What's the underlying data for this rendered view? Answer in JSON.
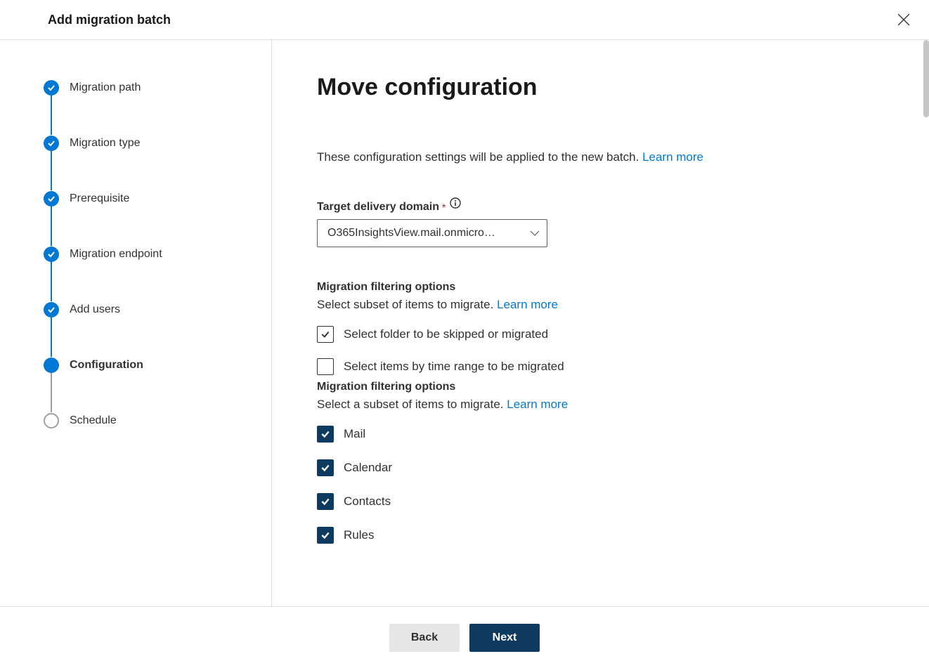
{
  "header": {
    "title": "Add migration batch"
  },
  "steps": [
    {
      "label": "Migration path",
      "state": "completed"
    },
    {
      "label": "Migration type",
      "state": "completed"
    },
    {
      "label": "Prerequisite",
      "state": "completed"
    },
    {
      "label": "Migration endpoint",
      "state": "completed"
    },
    {
      "label": "Add users",
      "state": "completed"
    },
    {
      "label": "Configuration",
      "state": "current"
    },
    {
      "label": "Schedule",
      "state": "upcoming"
    }
  ],
  "main": {
    "title": "Move configuration",
    "intro": "These configuration settings will be applied to the new batch. ",
    "learn_more": "Learn more",
    "domain_label": "Target delivery domain",
    "domain_value": "O365InsightsView.mail.onmicro…",
    "filter1_heading": "Migration filtering options",
    "filter1_sub": "Select subset of items to migrate. ",
    "cb_folder": "Select folder to be skipped or migrated",
    "cb_time": "Select items by time range to be migrated",
    "filter2_heading": "Migration filtering options",
    "filter2_sub": "Select a subset of items to migrate. ",
    "items": [
      "Mail",
      "Calendar",
      "Contacts",
      "Rules"
    ]
  },
  "footer": {
    "back": "Back",
    "next": "Next"
  }
}
